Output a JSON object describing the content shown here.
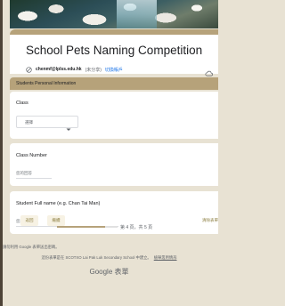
{
  "form": {
    "title": "School Pets Naming Competition",
    "account_email": "chenmf@lplss.edu.hk",
    "account_note": "(未分享)",
    "switch_account": "切換帳戶"
  },
  "section": {
    "title": "Students Personal Information"
  },
  "questions": {
    "class": {
      "label": "Class",
      "select_value": "選擇"
    },
    "class_number": {
      "label": "Class Number",
      "placeholder": "您的回答"
    },
    "full_name": {
      "label": "Student Full name (e.g. Chan Tai Man)",
      "placeholder": "您的回答"
    }
  },
  "nav": {
    "back": "返回",
    "next": "繼續",
    "page_count": "第 4 頁，共 5 頁",
    "progress_fraction": 0.8,
    "clear": "清除表單"
  },
  "footer": {
    "warning": "請勿利用 Google 表單送出密碼。",
    "note": "這份表單是在 SCOTXO Lai Pak Luk Secondary School 中建立。",
    "report": "檢舉濫用情形",
    "brand": "Google 表單"
  },
  "colors": {
    "accent": "#b6a27a",
    "background": "#e8e2d3",
    "link": "#1a73e8"
  },
  "icons": [
    "account-switch-icon",
    "cloud-icon",
    "chevron-down-icon"
  ]
}
